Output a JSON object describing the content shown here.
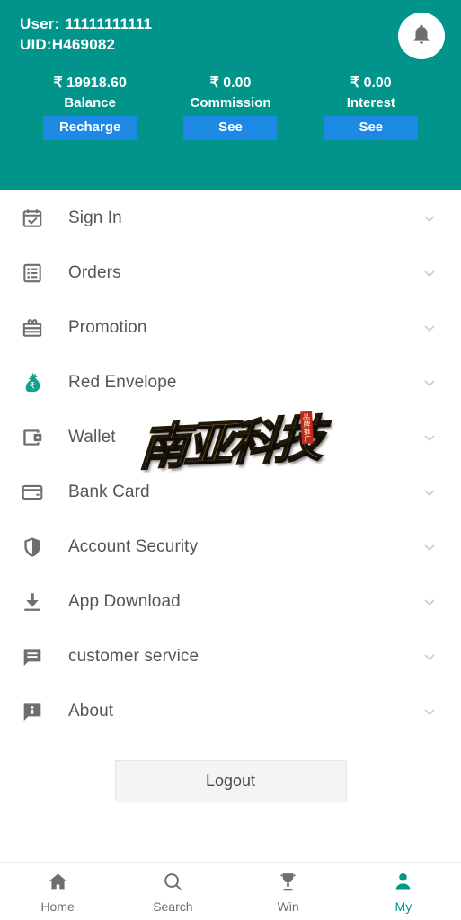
{
  "theme": {
    "primary": "#00948A",
    "accent_blue": "#1E88E5",
    "active_tab": "#009688",
    "icon_gray": "#6e6e6e",
    "text_gray": "#555555"
  },
  "header": {
    "user_label": "User:",
    "user_value": "11111111111",
    "uid_label": "UID:",
    "uid_value": "H469082",
    "notification_icon": "bell-icon",
    "stats": [
      {
        "amount": "₹ 19918.60",
        "label": "Balance",
        "button": "Recharge"
      },
      {
        "amount": "₹ 0.00",
        "label": "Commission",
        "button": "See"
      },
      {
        "amount": "₹ 0.00",
        "label": "Interest",
        "button": "See"
      }
    ]
  },
  "menu": {
    "items": [
      {
        "label": "Sign In",
        "icon": "calendar-check-icon",
        "chevron": "chevron-down-icon"
      },
      {
        "label": "Orders",
        "icon": "list-icon",
        "chevron": "chevron-down-icon"
      },
      {
        "label": "Promotion",
        "icon": "gift-icon",
        "chevron": "chevron-down-icon"
      },
      {
        "label": "Red Envelope",
        "icon": "money-bag-icon",
        "chevron": "chevron-down-icon"
      },
      {
        "label": "Wallet",
        "icon": "wallet-icon",
        "chevron": "chevron-down-icon"
      },
      {
        "label": "Bank Card",
        "icon": "credit-card-icon",
        "chevron": "chevron-down-icon"
      },
      {
        "label": "Account Security",
        "icon": "shield-icon",
        "chevron": "chevron-down-icon"
      },
      {
        "label": "App Download",
        "icon": "download-icon",
        "chevron": "chevron-down-icon"
      },
      {
        "label": "customer service",
        "icon": "chat-lines-icon",
        "chevron": "chevron-down-icon"
      },
      {
        "label": "About",
        "icon": "chat-info-icon",
        "chevron": "chevron-down-icon"
      }
    ]
  },
  "watermark": {
    "text": "南亚科技",
    "seal_text": "品牌推广"
  },
  "footer": {
    "logout_label": "Logout"
  },
  "tabbar": {
    "items": [
      {
        "label": "Home",
        "icon": "home-icon",
        "active": false
      },
      {
        "label": "Search",
        "icon": "search-icon",
        "active": false
      },
      {
        "label": "Win",
        "icon": "trophy-icon",
        "active": false
      },
      {
        "label": "My",
        "icon": "person-icon",
        "active": true
      }
    ]
  }
}
